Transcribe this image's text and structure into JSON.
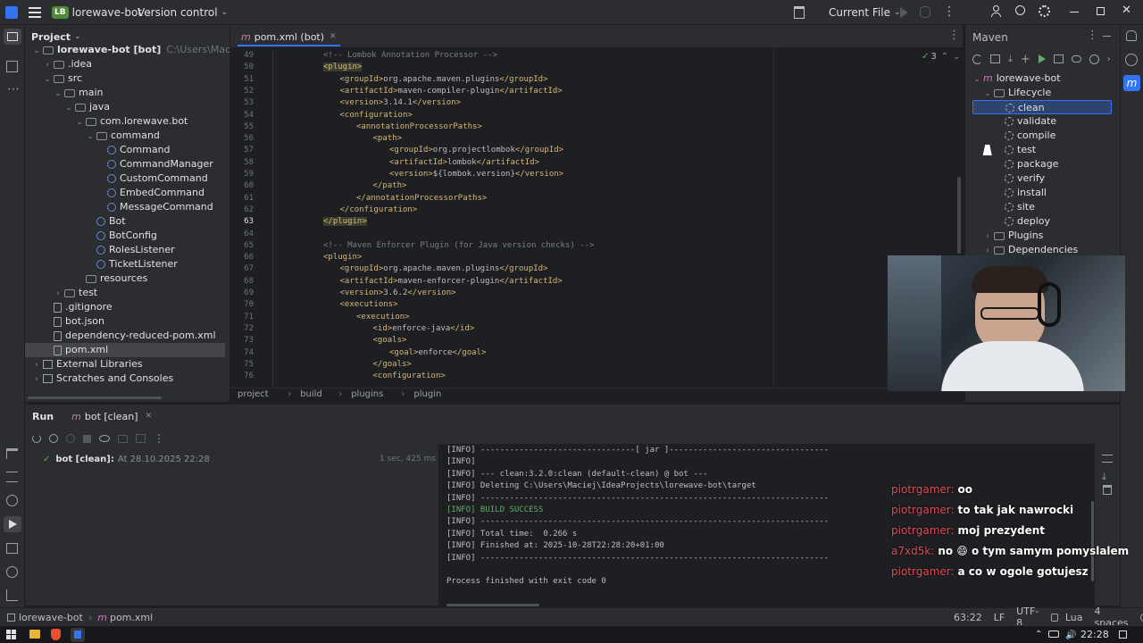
{
  "titlebar": {
    "app_badge": "LB",
    "project": "lorewave-bot",
    "vcs": "Version control",
    "run_config": "Current File"
  },
  "project_panel": {
    "title": "Project",
    "tree": [
      {
        "label": "lorewave-bot [bot]",
        "sub": "C:\\Users\\Maciej\\IdeaProjects",
        "indent": 0,
        "kind": "folder",
        "chev": "v"
      },
      {
        "label": ".idea",
        "indent": 1,
        "kind": "folder",
        "chev": ">"
      },
      {
        "label": "src",
        "indent": 1,
        "kind": "folder",
        "chev": "v"
      },
      {
        "label": "main",
        "indent": 2,
        "kind": "folder",
        "chev": "v"
      },
      {
        "label": "java",
        "indent": 3,
        "kind": "folder",
        "chev": "v"
      },
      {
        "label": "com.lorewave.bot",
        "indent": 4,
        "kind": "folder",
        "chev": "v"
      },
      {
        "label": "command",
        "indent": 5,
        "kind": "folder",
        "chev": "v"
      },
      {
        "label": "Command",
        "indent": 6,
        "kind": "class"
      },
      {
        "label": "CommandManager",
        "indent": 6,
        "kind": "class"
      },
      {
        "label": "CustomCommand",
        "indent": 6,
        "kind": "class"
      },
      {
        "label": "EmbedCommand",
        "indent": 6,
        "kind": "class"
      },
      {
        "label": "MessageCommand",
        "indent": 6,
        "kind": "class"
      },
      {
        "label": "Bot",
        "indent": 5,
        "kind": "class"
      },
      {
        "label": "BotConfig",
        "indent": 5,
        "kind": "class"
      },
      {
        "label": "RolesListener",
        "indent": 5,
        "kind": "class"
      },
      {
        "label": "TicketListener",
        "indent": 5,
        "kind": "class"
      },
      {
        "label": "resources",
        "indent": 4,
        "kind": "folder"
      },
      {
        "label": "test",
        "indent": 2,
        "kind": "folder",
        "chev": ">"
      },
      {
        "label": ".gitignore",
        "indent": 1,
        "kind": "file"
      },
      {
        "label": "bot.json",
        "indent": 1,
        "kind": "file"
      },
      {
        "label": "dependency-reduced-pom.xml",
        "indent": 1,
        "kind": "file"
      },
      {
        "label": "pom.xml",
        "indent": 1,
        "kind": "file",
        "selected": true
      },
      {
        "label": "External Libraries",
        "indent": 0,
        "kind": "lib",
        "chev": ">"
      },
      {
        "label": "Scratches and Consoles",
        "indent": 0,
        "kind": "lib",
        "chev": ">"
      }
    ]
  },
  "editor": {
    "tab": "pom.xml (bot)",
    "inspections": "3",
    "breadcrumbs": [
      "project",
      "build",
      "plugins",
      "plugin"
    ],
    "lines": [
      {
        "n": "49",
        "indent": 0,
        "html": "<span class='cmt'>&lt;!-- Lombok Annotation Processor --&gt;</span>"
      },
      {
        "n": "50",
        "indent": 0,
        "html": "<span class='tag'>&lt;plugin&gt;</span>"
      },
      {
        "n": "51",
        "indent": 1,
        "html": "<span class='tag'>&lt;groupId&gt;</span><span class='txt'>org.apache.maven.plugins</span><span class='tag'>&lt;/groupId&gt;</span>"
      },
      {
        "n": "52",
        "indent": 1,
        "html": "<span class='tag'>&lt;artifactId&gt;</span><span class='txt'>maven-compiler-plugin</span><span class='tag'>&lt;/artifactId&gt;</span>"
      },
      {
        "n": "53",
        "indent": 1,
        "html": "<span class='tag'>&lt;version&gt;</span><span class='txt'>3.14.1</span><span class='tag'>&lt;/version&gt;</span>"
      },
      {
        "n": "54",
        "indent": 1,
        "html": "<span class='tag'>&lt;configuration&gt;</span>"
      },
      {
        "n": "55",
        "indent": 2,
        "html": "<span class='tag'>&lt;annotationProcessorPaths&gt;</span>"
      },
      {
        "n": "56",
        "indent": 3,
        "html": "<span class='tag'>&lt;path&gt;</span>"
      },
      {
        "n": "57",
        "indent": 4,
        "html": "<span class='tag'>&lt;groupId&gt;</span><span class='txt'>org.projectlombok</span><span class='tag'>&lt;/groupId&gt;</span>"
      },
      {
        "n": "58",
        "indent": 4,
        "html": "<span class='tag'>&lt;artifactId&gt;</span><span class='txt'>lombok</span><span class='tag'>&lt;/artifactId&gt;</span>"
      },
      {
        "n": "59",
        "indent": 4,
        "html": "<span class='tag'>&lt;version&gt;</span><span class='txt'>${lombok.version}</span><span class='tag'>&lt;/version&gt;</span>"
      },
      {
        "n": "60",
        "indent": 3,
        "html": "<span class='tag'>&lt;/path&gt;</span>"
      },
      {
        "n": "61",
        "indent": 2,
        "html": "<span class='tag'>&lt;/annotationProcessorPaths&gt;</span>"
      },
      {
        "n": "62",
        "indent": 1,
        "html": "<span class='tag'>&lt;/configuration&gt;</span>"
      },
      {
        "n": "63",
        "indent": 0,
        "html": "<span class='tag'>&lt;/plugin&gt;</span>"
      },
      {
        "n": "64",
        "indent": 0,
        "html": ""
      },
      {
        "n": "65",
        "indent": 0,
        "html": "<span class='cmt'>&lt;!-- Maven Enforcer Plugin (for Java version checks) --&gt;</span>"
      },
      {
        "n": "66",
        "indent": 0,
        "html": "<span class='tag'>&lt;plugin&gt;</span>"
      },
      {
        "n": "67",
        "indent": 1,
        "html": "<span class='tag'>&lt;groupId&gt;</span><span class='txt'>org.apache.maven.plugins</span><span class='tag'>&lt;/groupId&gt;</span>"
      },
      {
        "n": "68",
        "indent": 1,
        "html": "<span class='tag'>&lt;artifactId&gt;</span><span class='txt'>maven-enforcer-plugin</span><span class='tag'>&lt;/artifactId&gt;</span>"
      },
      {
        "n": "69",
        "indent": 1,
        "html": "<span class='tag'>&lt;version&gt;</span><span class='txt'>3.6.2</span><span class='tag'>&lt;/version&gt;</span>"
      },
      {
        "n": "70",
        "indent": 1,
        "html": "<span class='tag'>&lt;executions&gt;</span>"
      },
      {
        "n": "71",
        "indent": 2,
        "html": "<span class='tag'>&lt;execution&gt;</span>"
      },
      {
        "n": "72",
        "indent": 3,
        "html": "<span class='tag'>&lt;id&gt;</span><span class='txt'>enforce-java</span><span class='tag'>&lt;/id&gt;</span>"
      },
      {
        "n": "73",
        "indent": 3,
        "html": "<span class='tag'>&lt;goals&gt;</span>"
      },
      {
        "n": "74",
        "indent": 4,
        "html": "<span class='tag'>&lt;goal&gt;</span><span class='txt'>enforce</span><span class='tag'>&lt;/goal&gt;</span>"
      },
      {
        "n": "75",
        "indent": 3,
        "html": "<span class='tag'>&lt;/goals&gt;</span>"
      },
      {
        "n": "76",
        "indent": 3,
        "html": "<span class='tag'>&lt;configuration&gt;</span>"
      }
    ]
  },
  "maven": {
    "title": "Maven",
    "root": "lorewave-bot",
    "lifecycle": "Lifecycle",
    "goals": [
      "clean",
      "validate",
      "compile",
      "test",
      "package",
      "verify",
      "install",
      "site",
      "deploy"
    ],
    "plugins": "Plugins",
    "dependencies": "Dependencies"
  },
  "run": {
    "tab_run": "Run",
    "tab_config": "bot [clean]",
    "entry_label": "bot [clean]:",
    "entry_time": "At 28.10.2025 22:28",
    "entry_duration": "1 sec, 425 ms",
    "console": [
      "[INFO] --------------------------------[ jar ]---------------------------------",
      "[INFO]",
      "[INFO] --- clean:3.2.0:clean (default-clean) @ bot ---",
      "[INFO] Deleting C:\\Users\\Maciej\\IdeaProjects\\lorewave-bot\\target",
      "[INFO] ------------------------------------------------------------------------",
      "[INFO] BUILD SUCCESS",
      "[INFO] ------------------------------------------------------------------------",
      "[INFO] Total time:  0.266 s",
      "[INFO] Finished at: 2025-10-28T22:28:20+01:00",
      "[INFO] ------------------------------------------------------------------------",
      "",
      "Process finished with exit code 0"
    ]
  },
  "chat": [
    {
      "user": "piotrgamer:",
      "msg": "oo"
    },
    {
      "user": "piotrgamer:",
      "msg": "to tak jak nawrocki"
    },
    {
      "user": "piotrgamer:",
      "msg": "moj prezydent"
    },
    {
      "user": "a7xd5k:",
      "msg": "no 😄 o tym samym pomyslalem"
    },
    {
      "user": "piotrgamer:",
      "msg": "a co w ogole gotujesz"
    }
  ],
  "statusbar": {
    "crumb_project": "lorewave-bot",
    "crumb_file": "pom.xml",
    "position": "63:22",
    "line_sep": "LF",
    "encoding": "UTF-8",
    "lang": "Lua",
    "indent": "4 spaces"
  },
  "taskbar": {
    "clock": "22:28"
  },
  "colors": {
    "accent": "#3574f0",
    "chat_user": "#e24b57",
    "tag": "#d5b778",
    "background": "#1e1f22",
    "panel": "#2b2d30"
  }
}
